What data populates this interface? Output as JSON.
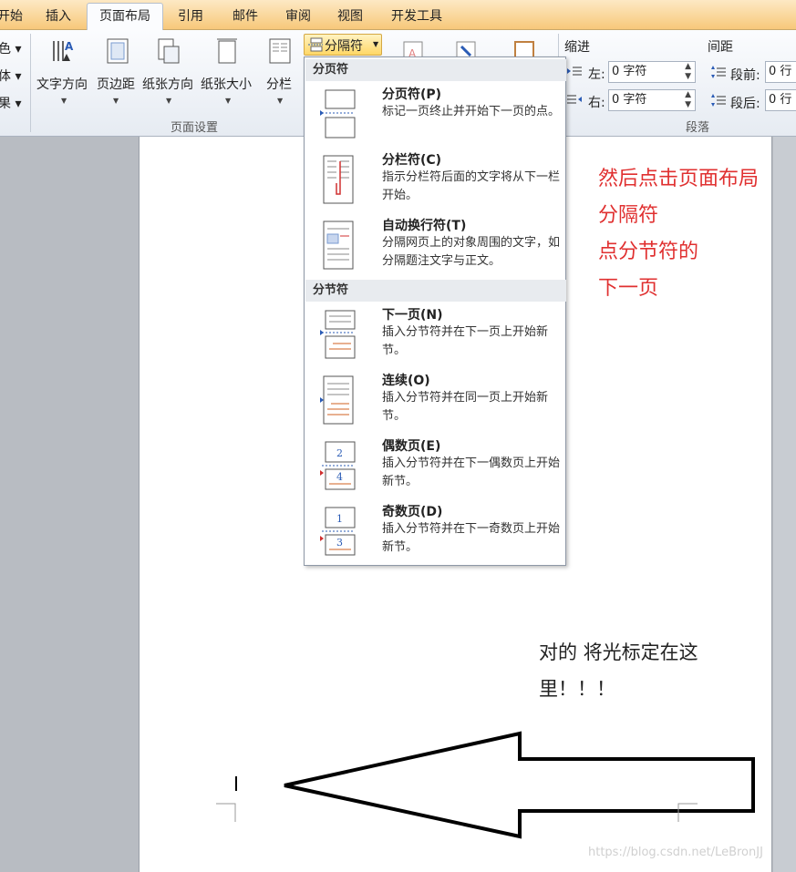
{
  "tabs": [
    "开始",
    "插入",
    "页面布局",
    "引用",
    "邮件",
    "审阅",
    "视图",
    "开发工具"
  ],
  "ribbon": {
    "left_cut": [
      "色 ▾",
      "体 ▾",
      "果 ▾"
    ],
    "page_setup_buttons": [
      "文字方向",
      "页边距",
      "纸张方向",
      "纸张大小",
      "分栏"
    ],
    "page_setup_caption": "页面设置",
    "breaks_button": "分隔符",
    "indent": {
      "title": "缩进",
      "left_label": "左:",
      "left_value": "0 字符",
      "right_label": "右:",
      "right_value": "0 字符"
    },
    "spacing": {
      "title": "间距",
      "before_label": "段前:",
      "before_value": "0 行",
      "after_label": "段后:",
      "after_value": "0 行"
    },
    "paragraph_caption": "段落"
  },
  "menu": {
    "page_breaks_header": "分页符",
    "section_breaks_header": "分节符",
    "items": [
      {
        "title": "分页符(P)",
        "desc": "标记一页终止并开始下一页的点。"
      },
      {
        "title": "分栏符(C)",
        "desc": "指示分栏符后面的文字将从下一栏开始。"
      },
      {
        "title": "自动换行符(T)",
        "desc": "分隔网页上的对象周围的文字，如分隔题注文字与正文。"
      },
      {
        "title": "下一页(N)",
        "desc": "插入分节符并在下一页上开始新节。"
      },
      {
        "title": "连续(O)",
        "desc": "插入分节符并在同一页上开始新节。"
      },
      {
        "title": "偶数页(E)",
        "desc": "插入分节符并在下一偶数页上开始新节。"
      },
      {
        "title": "奇数页(D)",
        "desc": "插入分节符并在下一奇数页上开始新节。"
      }
    ]
  },
  "annotations": {
    "red_lines": [
      "然后点击页面布局",
      "分隔符",
      "点分节符的",
      "下一页"
    ],
    "black_lines": [
      "对的  将光标定在这",
      "里！！！"
    ]
  },
  "watermark": "https://blog.csdn.net/LeBronJJ",
  "colors": {
    "annotation_red": "#e03030",
    "active_tab": "#fbfcfe",
    "highlight": "#ffd766"
  }
}
